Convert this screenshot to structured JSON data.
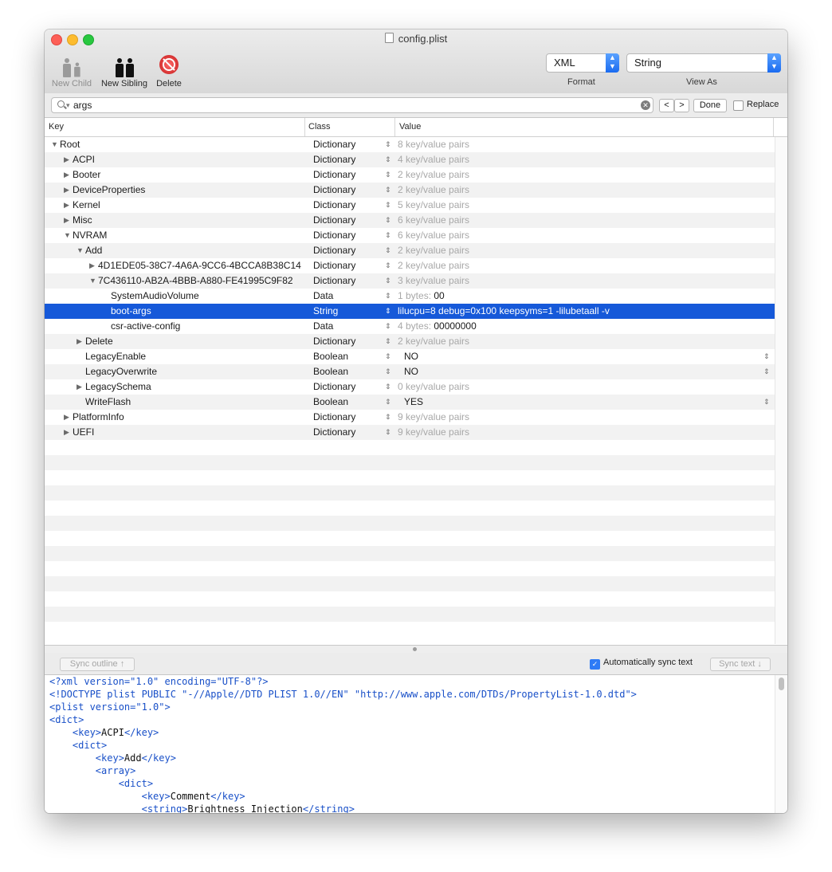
{
  "window": {
    "title": "config.plist"
  },
  "toolbar": {
    "new_child": "New Child",
    "new_sibling": "New Sibling",
    "delete": "Delete",
    "format_value": "XML",
    "format_label": "Format",
    "viewas_value": "String",
    "viewas_label": "View As"
  },
  "findbar": {
    "query": "args",
    "prev": "<",
    "next": ">",
    "done": "Done",
    "replace_label": "Replace",
    "replace_checked": false
  },
  "columns": {
    "key": "Key",
    "class": "Class",
    "value": "Value"
  },
  "rows": [
    {
      "key": "Root",
      "depth": 0,
      "disclosure": "open",
      "class": "Dictionary",
      "value": "8 key/value pairs",
      "value_style": "hint"
    },
    {
      "key": "ACPI",
      "depth": 1,
      "disclosure": "closed",
      "class": "Dictionary",
      "value": "4 key/value pairs",
      "value_style": "hint"
    },
    {
      "key": "Booter",
      "depth": 1,
      "disclosure": "closed",
      "class": "Dictionary",
      "value": "2 key/value pairs",
      "value_style": "hint"
    },
    {
      "key": "DeviceProperties",
      "depth": 1,
      "disclosure": "closed",
      "class": "Dictionary",
      "value": "2 key/value pairs",
      "value_style": "hint"
    },
    {
      "key": "Kernel",
      "depth": 1,
      "disclosure": "closed",
      "class": "Dictionary",
      "value": "5 key/value pairs",
      "value_style": "hint"
    },
    {
      "key": "Misc",
      "depth": 1,
      "disclosure": "closed",
      "class": "Dictionary",
      "value": "6 key/value pairs",
      "value_style": "hint"
    },
    {
      "key": "NVRAM",
      "depth": 1,
      "disclosure": "open",
      "class": "Dictionary",
      "value": "6 key/value pairs",
      "value_style": "hint"
    },
    {
      "key": "Add",
      "depth": 2,
      "disclosure": "open",
      "class": "Dictionary",
      "value": "2 key/value pairs",
      "value_style": "hint"
    },
    {
      "key": "4D1EDE05-38C7-4A6A-9CC6-4BCCA8B38C14",
      "depth": 3,
      "disclosure": "closed",
      "class": "Dictionary",
      "value": "2 key/value pairs",
      "value_style": "hint"
    },
    {
      "key": "7C436110-AB2A-4BBB-A880-FE41995C9F82",
      "depth": 3,
      "disclosure": "open",
      "class": "Dictionary",
      "value": "3 key/value pairs",
      "value_style": "hint"
    },
    {
      "key": "SystemAudioVolume",
      "depth": 4,
      "disclosure": "none",
      "class": "Data",
      "value_prefix": "1 bytes: ",
      "value": "00",
      "value_style": "data"
    },
    {
      "key": "boot-args",
      "depth": 4,
      "disclosure": "none",
      "class": "String",
      "value": "lilucpu=8 debug=0x100 keepsyms=1 -lilubetaall -v",
      "value_style": "normal",
      "selected": true
    },
    {
      "key": "csr-active-config",
      "depth": 4,
      "disclosure": "none",
      "class": "Data",
      "value_prefix": "4 bytes: ",
      "value": "00000000",
      "value_style": "data"
    },
    {
      "key": "Delete",
      "depth": 2,
      "disclosure": "closed",
      "class": "Dictionary",
      "value": "2 key/value pairs",
      "value_style": "hint"
    },
    {
      "key": "LegacyEnable",
      "depth": 2,
      "disclosure": "none",
      "class": "Boolean",
      "value": "NO",
      "value_style": "bool"
    },
    {
      "key": "LegacyOverwrite",
      "depth": 2,
      "disclosure": "none",
      "class": "Boolean",
      "value": "NO",
      "value_style": "bool"
    },
    {
      "key": "LegacySchema",
      "depth": 2,
      "disclosure": "closed",
      "class": "Dictionary",
      "value": "0 key/value pairs",
      "value_style": "hint"
    },
    {
      "key": "WriteFlash",
      "depth": 2,
      "disclosure": "none",
      "class": "Boolean",
      "value": "YES",
      "value_style": "bool"
    },
    {
      "key": "PlatformInfo",
      "depth": 1,
      "disclosure": "closed",
      "class": "Dictionary",
      "value": "9 key/value pairs",
      "value_style": "hint"
    },
    {
      "key": "UEFI",
      "depth": 1,
      "disclosure": "closed",
      "class": "Dictionary",
      "value": "9 key/value pairs",
      "value_style": "hint"
    }
  ],
  "syncbar": {
    "sync_outline": "Sync outline ↑",
    "auto_sync_label": "Automatically sync text",
    "auto_sync_checked": true,
    "sync_text": "Sync text ↓"
  },
  "xml_lines": [
    {
      "indent": 0,
      "parts": [
        [
          "tag",
          "<?xml version=\"1.0\" encoding=\"UTF-8\"?>"
        ]
      ]
    },
    {
      "indent": 0,
      "parts": [
        [
          "tag",
          "<!DOCTYPE plist PUBLIC \"-//Apple//DTD PLIST 1.0//EN\" \"http://www.apple.com/DTDs/PropertyList-1.0.dtd\">"
        ]
      ]
    },
    {
      "indent": 0,
      "parts": [
        [
          "tag",
          "<plist version=\"1.0\">"
        ]
      ]
    },
    {
      "indent": 0,
      "parts": [
        [
          "tag",
          "<dict>"
        ]
      ]
    },
    {
      "indent": 1,
      "parts": [
        [
          "tag",
          "<key>"
        ],
        [
          "txt",
          "ACPI"
        ],
        [
          "tag",
          "</key>"
        ]
      ]
    },
    {
      "indent": 1,
      "parts": [
        [
          "tag",
          "<dict>"
        ]
      ]
    },
    {
      "indent": 2,
      "parts": [
        [
          "tag",
          "<key>"
        ],
        [
          "txt",
          "Add"
        ],
        [
          "tag",
          "</key>"
        ]
      ]
    },
    {
      "indent": 2,
      "parts": [
        [
          "tag",
          "<array>"
        ]
      ]
    },
    {
      "indent": 3,
      "parts": [
        [
          "tag",
          "<dict>"
        ]
      ]
    },
    {
      "indent": 4,
      "parts": [
        [
          "tag",
          "<key>"
        ],
        [
          "txt",
          "Comment"
        ],
        [
          "tag",
          "</key>"
        ]
      ]
    },
    {
      "indent": 4,
      "parts": [
        [
          "tag",
          "<string>"
        ],
        [
          "txt",
          "Brightness Injection"
        ],
        [
          "tag",
          "</string>"
        ]
      ]
    }
  ]
}
